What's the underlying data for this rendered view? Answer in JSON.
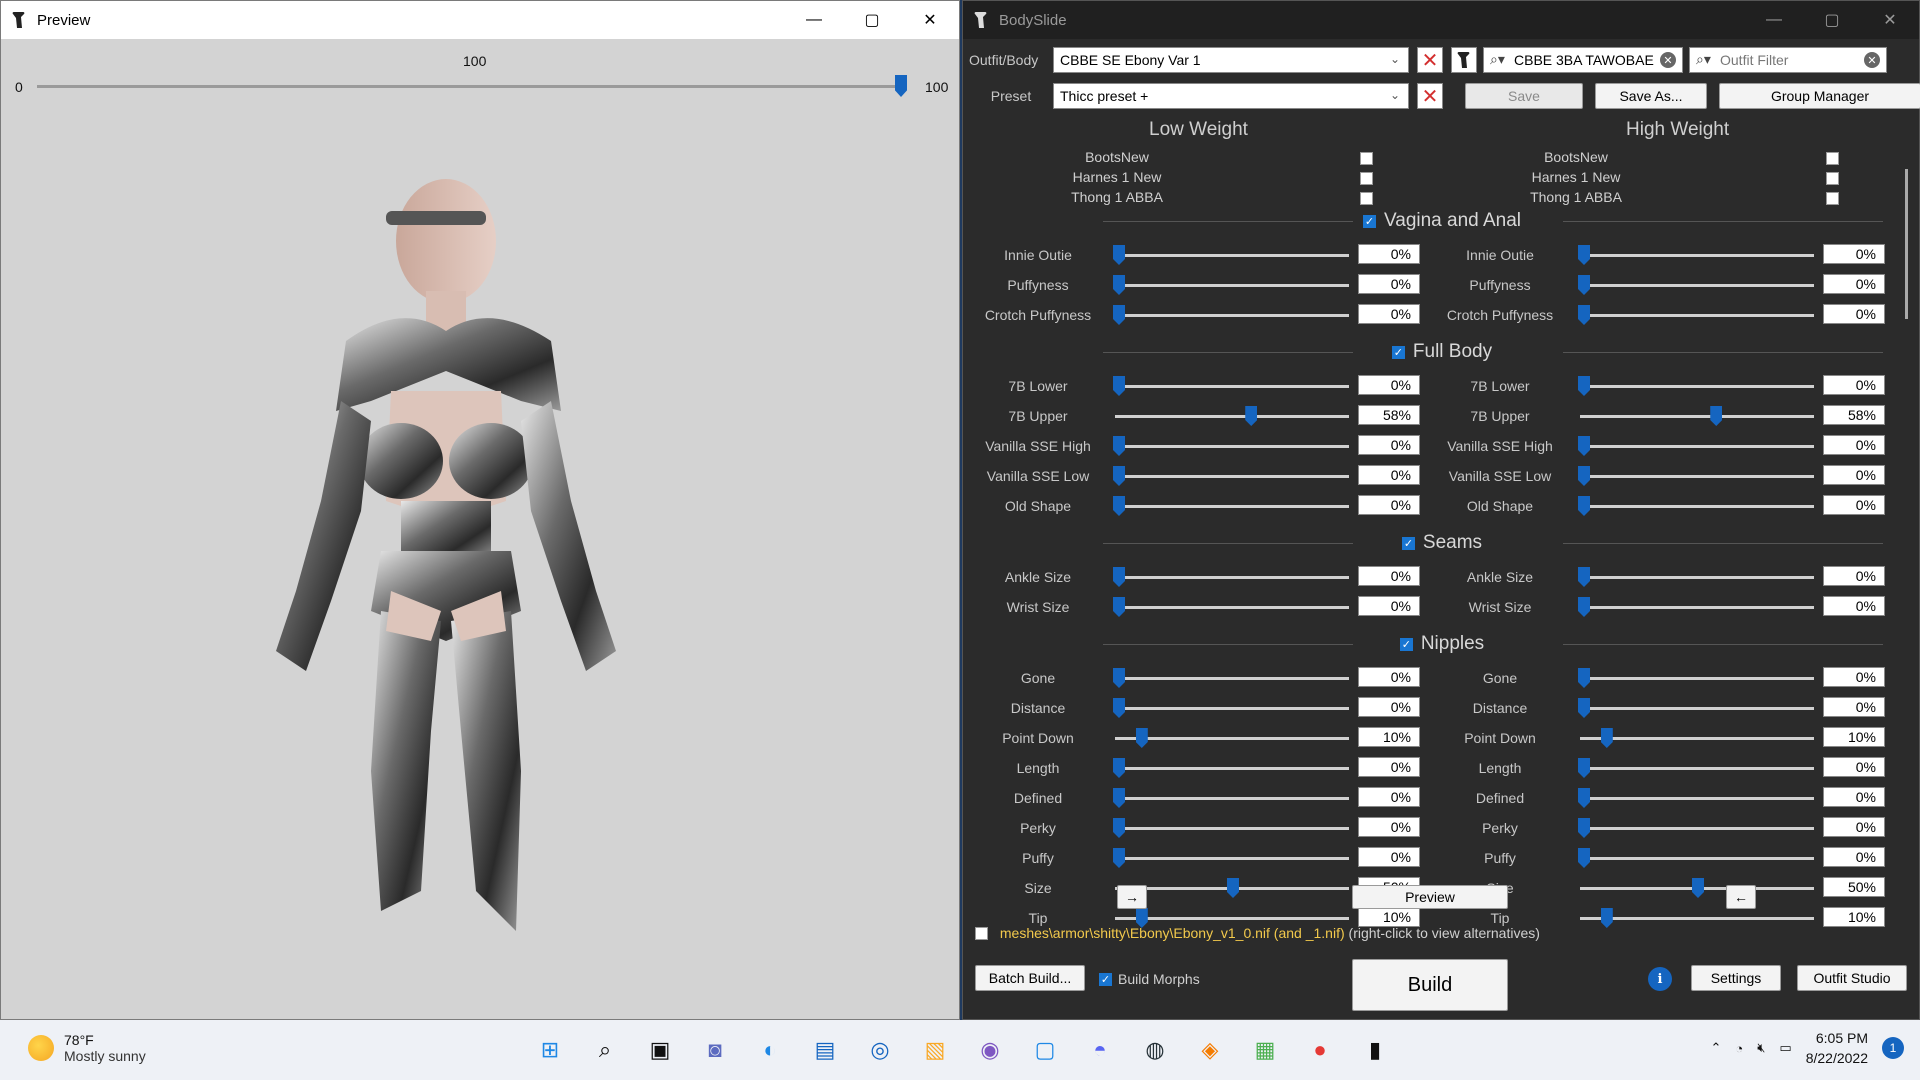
{
  "preview": {
    "title": "Preview",
    "slider_value": "100",
    "slider_min": "0",
    "slider_max": "100",
    "slider_level": 1.0
  },
  "bodyslide": {
    "title": "BodySlide",
    "outfit_label": "Outfit/Body",
    "outfit_value": "CBBE SE Ebony Var 1",
    "search_value": "CBBE 3BA TAWOBAE",
    "outfit_filter_placeholder": "Outfit Filter",
    "preset_label": "Preset",
    "preset_value": "Thicc preset +",
    "save_label": "Save",
    "save_as_label": "Save As...",
    "group_manager_label": "Group Manager",
    "low_weight": "Low Weight",
    "high_weight": "High Weight",
    "zap_items": [
      "BootsNew",
      "Harnes 1 New",
      "Thong 1 ABBA"
    ],
    "groups": [
      {
        "name": "Vagina and Anal",
        "sliders": [
          {
            "name": "Innie Outie",
            "low": "0%",
            "high": "0%",
            "lv": 0,
            "hv": 0
          },
          {
            "name": "Puffyness",
            "low": "0%",
            "high": "0%",
            "lv": 0,
            "hv": 0
          },
          {
            "name": "Crotch Puffyness",
            "low": "0%",
            "high": "0%",
            "lv": 0,
            "hv": 0
          }
        ]
      },
      {
        "name": "Full Body",
        "sliders": [
          {
            "name": "7B Lower",
            "low": "0%",
            "high": "0%",
            "lv": 0,
            "hv": 0
          },
          {
            "name": "7B Upper",
            "low": "58%",
            "high": "58%",
            "lv": 58,
            "hv": 58
          },
          {
            "name": "Vanilla SSE High",
            "low": "0%",
            "high": "0%",
            "lv": 0,
            "hv": 0
          },
          {
            "name": "Vanilla SSE Low",
            "low": "0%",
            "high": "0%",
            "lv": 0,
            "hv": 0
          },
          {
            "name": "Old Shape",
            "low": "0%",
            "high": "0%",
            "lv": 0,
            "hv": 0
          }
        ]
      },
      {
        "name": "Seams",
        "sliders": [
          {
            "name": "Ankle Size",
            "low": "0%",
            "high": "0%",
            "lv": 0,
            "hv": 0
          },
          {
            "name": "Wrist Size",
            "low": "0%",
            "high": "0%",
            "lv": 0,
            "hv": 0
          }
        ]
      },
      {
        "name": "Nipples",
        "sliders": [
          {
            "name": "Gone",
            "low": "0%",
            "high": "0%",
            "lv": 0,
            "hv": 0
          },
          {
            "name": "Distance",
            "low": "0%",
            "high": "0%",
            "lv": 0,
            "hv": 0
          },
          {
            "name": "Point Down",
            "low": "10%",
            "high": "10%",
            "lv": 10,
            "hv": 10
          },
          {
            "name": "Length",
            "low": "0%",
            "high": "0%",
            "lv": 0,
            "hv": 0
          },
          {
            "name": "Defined",
            "low": "0%",
            "high": "0%",
            "lv": 0,
            "hv": 0
          },
          {
            "name": "Perky",
            "low": "0%",
            "high": "0%",
            "lv": 0,
            "hv": 0
          },
          {
            "name": "Puffy",
            "low": "0%",
            "high": "0%",
            "lv": 0,
            "hv": 0
          },
          {
            "name": "Size",
            "low": "50%",
            "high": "50%",
            "lv": 50,
            "hv": 50
          },
          {
            "name": "Tip",
            "low": "10%",
            "high": "10%",
            "lv": 10,
            "hv": 10
          }
        ]
      }
    ],
    "copy_right_label": "→",
    "preview_button": "Preview",
    "copy_left_label": "←",
    "path": "meshes\\armor\\shitty\\Ebony\\Ebony_v1_0.nif (and _1.nif)",
    "path_hint": "(right-click to view alternatives)",
    "batch_build_label": "Batch Build...",
    "build_morphs_label": "Build Morphs",
    "build_label": "Build",
    "settings_label": "Settings",
    "outfit_studio_label": "Outfit Studio",
    "accent_color": "#1565c0"
  },
  "taskbar": {
    "temperature": "78°F",
    "weather": "Mostly sunny",
    "time": "6:05 PM",
    "date": "8/22/2022",
    "notifications": "1",
    "icons": [
      "windows-start-icon",
      "search-icon",
      "task-view-icon",
      "chat-icon",
      "edge-icon",
      "store-icon",
      "app-icon",
      "file-explorer-icon",
      "app2-icon",
      "app3-icon",
      "discord-icon",
      "steam-icon",
      "app4-icon",
      "minecraft-icon",
      "chrome-icon",
      "bodyslide-icon"
    ]
  }
}
